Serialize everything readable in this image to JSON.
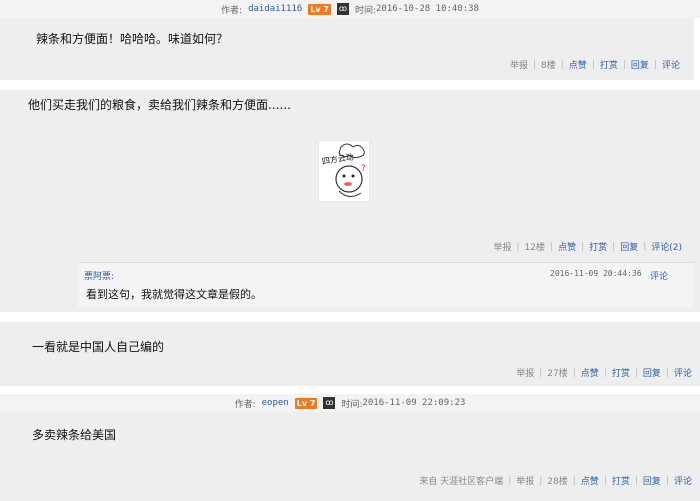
{
  "post1": {
    "meta": {
      "author_label": "作者:",
      "author": "daidai1116",
      "level": "Lv 7",
      "badge": "ꝏ",
      "time_label": "时间:",
      "time": "2016-10-28 10:40:38"
    },
    "text": "辣条和方便面！哈哈哈。味道如何？",
    "actions": {
      "report": "举报",
      "floor": "8楼",
      "like": "点赞",
      "tip": "打赏",
      "reply": "回复",
      "comment": "评论"
    }
  },
  "post2": {
    "text": "他们买走我们的粮食，卖给我们辣条和方便面......",
    "sticker": {
      "caption": "四方云动",
      "icon": "sticker-image"
    },
    "actions": {
      "report": "举报",
      "floor": "12楼",
      "like": "点赞",
      "tip": "打赏",
      "reply": "回复",
      "comment": "评论(2)"
    },
    "reply": {
      "name": "票阿票:",
      "time": "2016-11-09 20:44:36",
      "comment": "评论",
      "text": "看到这句，我就觉得这文章是假的。"
    }
  },
  "post3": {
    "text": "一看就是中国人自己编的",
    "actions": {
      "report": "举报",
      "floor": "27楼",
      "like": "点赞",
      "tip": "打赏",
      "reply": "回复",
      "comment": "评论"
    }
  },
  "post4": {
    "meta": {
      "author_label": "作者:",
      "author": "eopen",
      "level": "Lv 7",
      "badge": "ꝏ",
      "time_label": "时间:",
      "time": "2016-11-09 22:09:23"
    },
    "text": "多卖辣条给美国",
    "actions": {
      "source": "来自 天涯社区客户端",
      "report": "举报",
      "floor": "28楼",
      "like": "点赞",
      "tip": "打赏",
      "reply": "回复",
      "comment": "评论"
    }
  }
}
